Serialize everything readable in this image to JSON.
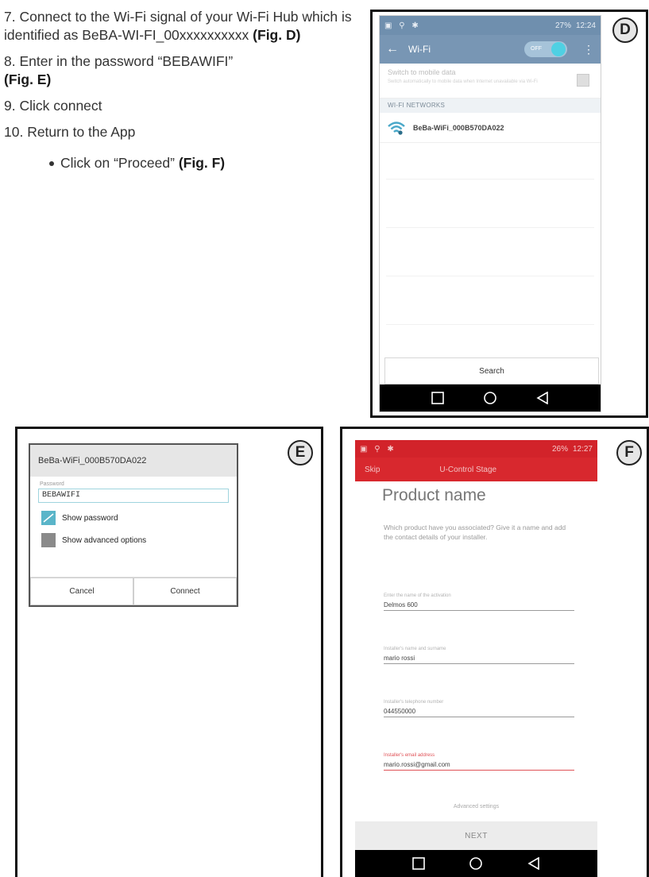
{
  "steps": {
    "s7_text": "7. Connect to the Wi-Fi signal of your Wi-Fi Hub which is identified as BeBA-WI-FI_00xxxxxxxxxx",
    "s7_ref": "(Fig. D)",
    "s8_text": "8. Enter in the password “BEBAWIFI”",
    "s8_ref": "(Fig. E)",
    "s9_text": "9. Click connect",
    "s10_text": "10. Return to the App",
    "bullet_text": "Click on “Proceed”",
    "bullet_ref": "(Fig. F)"
  },
  "figD": {
    "badge": "D",
    "status_time": "12:24",
    "status_battery": "27%",
    "title": "Wi-Fi",
    "toggle_off": "OFF",
    "mobile_data_label": "Switch to mobile data",
    "mobile_data_desc": "Switch automatically to mobile data when Internet unavailable via Wi-Fi",
    "section": "WI-FI NETWORKS",
    "network_name": "BeBa-WiFi_000B570DA022",
    "search_label": "Search"
  },
  "figE": {
    "badge": "E",
    "dialog_title": "BeBa-WiFi_000B570DA022",
    "password_label": "Password",
    "password_value": "BEBAWIFI",
    "show_password": "Show password",
    "show_advanced": "Show advanced options",
    "cancel": "Cancel",
    "connect": "Connect"
  },
  "figF": {
    "badge": "F",
    "status_time": "12:27",
    "status_battery": "26%",
    "skip": "Skip",
    "stage_title": "U-Control Stage",
    "heading": "Product name",
    "description": "Which product have you associated? Give it a name and add the contact details of your installer.",
    "fields": [
      {
        "label": "Enter the name of the activation",
        "value": "Delmos 600"
      },
      {
        "label": "Installer's name and surname",
        "value": "mario rossi"
      },
      {
        "label": "Installer's telephone number",
        "value": "044550000"
      },
      {
        "label": "Installer's email address",
        "value": "mario.rossi@gmail.com"
      }
    ],
    "advanced": "Advanced settings",
    "next": "NEXT"
  },
  "colors": {
    "android_blue_bar": "#7896b4",
    "app_red": "#d8282e",
    "accent_teal": "#4fd0e3",
    "error_red": "#e05257"
  }
}
